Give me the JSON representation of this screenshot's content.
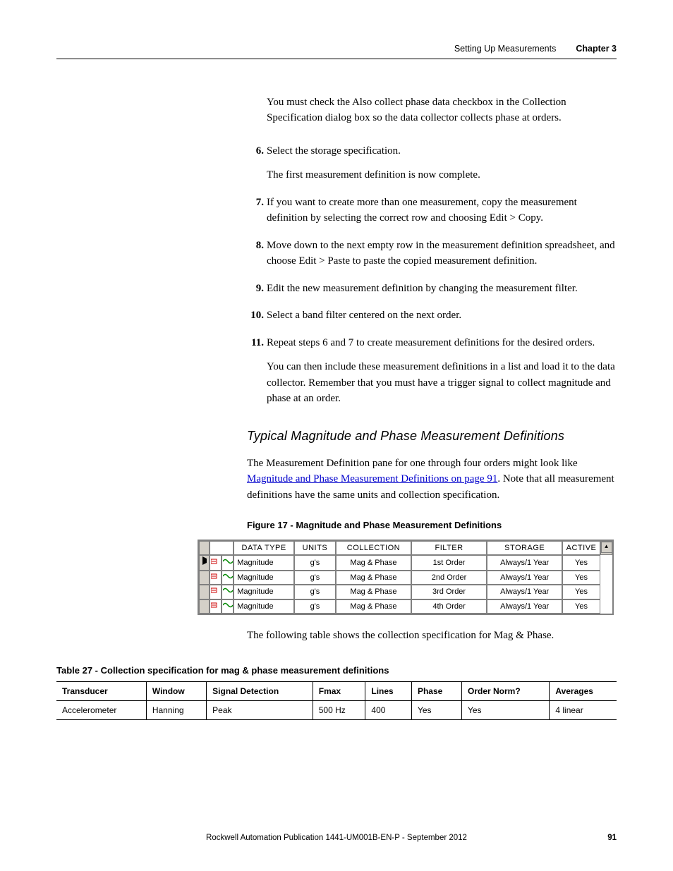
{
  "header": {
    "section": "Setting Up Measurements",
    "chapter": "Chapter 3"
  },
  "intro_para": "You must check the Also collect phase data checkbox in the Collection Specification dialog box so the data collector collects phase at orders.",
  "steps": {
    "s6_num": "6.",
    "s6_text": "Select the storage specification.",
    "s6_follow": "The first measurement definition is now complete.",
    "s7_num": "7.",
    "s7_text": "If you want to create more than one measurement, copy the measurement definition by selecting the correct row and choosing Edit > Copy.",
    "s8_num": "8.",
    "s8_text": "Move down to the next empty row in the measurement definition spreadsheet, and choose Edit > Paste to paste the copied measurement definition.",
    "s9_num": "9.",
    "s9_text": "Edit the new measurement definition by changing the measurement filter.",
    "s10_num": "10.",
    "s10_text": "Select a band filter centered on the next order.",
    "s11_num": "11.",
    "s11_text": "Repeat steps 6 and 7 to create measurement definitions for the desired orders.",
    "s11_follow": "You can then include these measurement definitions in a list and load it to the data collector. Remember that you must have a trigger signal to collect magnitude and phase at an order."
  },
  "subhead": "Typical Magnitude and Phase Measurement Definitions",
  "para2_pre": "The Measurement Definition pane for one through four orders might look like ",
  "para2_link": "Magnitude and Phase Measurement Definitions on page 91",
  "para2_post": ". Note that all measurement definitions have the same units and collection specification.",
  "fig_caption": "Figure 17 - Magnitude and Phase Measurement Definitions",
  "fig": {
    "headers": {
      "c1": "DATA TYPE",
      "c2": "UNITS",
      "c3": "COLLECTION",
      "c4": "FILTER",
      "c5": "STORAGE",
      "c6": "ACTIVE"
    },
    "rows": [
      {
        "data_type": "Magnitude",
        "units": "g's",
        "collection": "Mag & Phase",
        "filter": "1st Order",
        "storage": "Always/1 Year",
        "active": "Yes"
      },
      {
        "data_type": "Magnitude",
        "units": "g's",
        "collection": "Mag & Phase",
        "filter": "2nd Order",
        "storage": "Always/1 Year",
        "active": "Yes"
      },
      {
        "data_type": "Magnitude",
        "units": "g's",
        "collection": "Mag & Phase",
        "filter": "3rd Order",
        "storage": "Always/1 Year",
        "active": "Yes"
      },
      {
        "data_type": "Magnitude",
        "units": "g's",
        "collection": "Mag & Phase",
        "filter": "4th Order",
        "storage": "Always/1 Year",
        "active": "Yes"
      }
    ]
  },
  "following_note": "The following table shows the collection specification for Mag & Phase.",
  "tbl27_caption": "Table 27 - Collection specification for mag & phase measurement definitions",
  "tbl27": {
    "headers": {
      "h1": "Transducer",
      "h2": "Window",
      "h3": "Signal Detection",
      "h4": "Fmax",
      "h5": "Lines",
      "h6": "Phase",
      "h7": "Order Norm?",
      "h8": "Averages"
    },
    "row": {
      "c1": "Accelerometer",
      "c2": "Hanning",
      "c3": "Peak",
      "c4": "500 Hz",
      "c5": "400",
      "c6": "Yes",
      "c7": "Yes",
      "c8": "4 linear"
    }
  },
  "footer": {
    "text": "Rockwell Automation Publication 1441-UM001B-EN-P - September 2012",
    "page": "91"
  }
}
